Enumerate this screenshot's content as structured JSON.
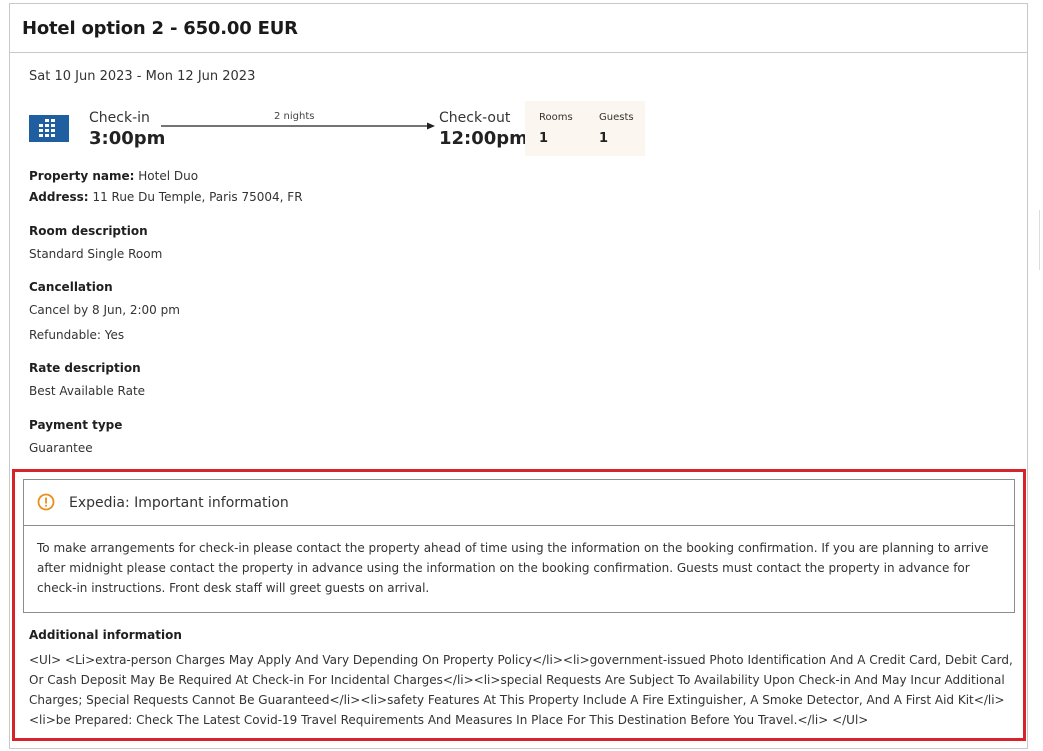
{
  "header": {
    "title": "Hotel option 2 - 650.00 EUR"
  },
  "stay": {
    "dates": "Sat 10 Jun 2023 - Mon 12 Jun 2023",
    "checkin_label": "Check-in",
    "checkin_time": "3:00pm",
    "nights": "2 nights",
    "checkout_label": "Check-out",
    "checkout_time": "12:00pm",
    "rooms_label": "Rooms",
    "rooms_value": "1",
    "guests_label": "Guests",
    "guests_value": "1"
  },
  "property": {
    "name_label": "Property name:",
    "name_value": "Hotel Duo",
    "address_label": "Address:",
    "address_value": "11 Rue Du Temple, Paris 75004, FR"
  },
  "room": {
    "heading": "Room description",
    "value": "Standard Single Room"
  },
  "cancellation": {
    "heading": "Cancellation",
    "line1": "Cancel by 8 Jun, 2:00 pm",
    "line2": "Refundable: Yes"
  },
  "rate": {
    "heading": "Rate description",
    "value": "Best Available Rate"
  },
  "payment": {
    "heading": "Payment type",
    "value": "Guarantee"
  },
  "important": {
    "title": "Expedia: Important information",
    "body": "To make arrangements for check-in please contact the property ahead of time using the information on the booking confirmation. If you are planning to arrive after midnight please contact the property in advance using the information on the booking confirmation. Guests must contact the property in advance for check-in instructions. Front desk staff will greet guests on arrival."
  },
  "additional": {
    "heading": "Additional information",
    "body": "<Ul> <Li>extra-person Charges May Apply And Vary Depending On Property Policy</li><li>government-issued Photo Identification And A Credit Card, Debit Card, Or Cash Deposit May Be Required At Check-in For Incidental Charges</li><li>special Requests Are Subject To Availability Upon Check-in And May Incur Additional Charges; Special Requests Cannot Be Guaranteed</li><li>safety Features At This Property Include A Fire Extinguisher, A Smoke Detector, And A First Aid Kit</li><li>be Prepared: Check The Latest Covid-19 Travel Requirements And Measures In Place For This Destination Before You Travel.</li> </Ul>"
  },
  "colors": {
    "accent_blue": "#1f5fa0",
    "warning_orange": "#e8901a",
    "highlight_red": "#d7242c",
    "rooms_bg": "#fbf6ef"
  },
  "icons": {
    "hotel": "hotel-building-icon",
    "warning": "warning-circle-icon"
  }
}
